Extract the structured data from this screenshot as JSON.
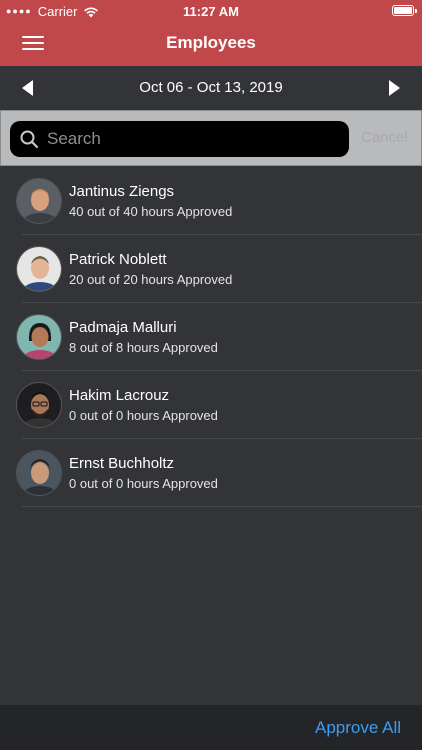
{
  "status_bar": {
    "carrier": "Carrier",
    "time": "11:27 AM"
  },
  "nav": {
    "title": "Employees",
    "menu_icon": "hamburger-menu-icon"
  },
  "week": {
    "range": "Oct 06 - Oct 13, 2019",
    "prev_icon": "triangle-left-icon",
    "next_icon": "triangle-right-icon"
  },
  "search": {
    "placeholder": "Search",
    "value": "",
    "cancel_label": "Cancel"
  },
  "employees": [
    {
      "name": "Jantinus Ziengs",
      "hours": "40 out of 40 hours Approved"
    },
    {
      "name": "Patrick Noblett",
      "hours": "20 out of 20 hours Approved"
    },
    {
      "name": "Padmaja Malluri",
      "hours": "8 out of 8 hours Approved"
    },
    {
      "name": "Hakim Lacrouz",
      "hours": "0 out of 0 hours Approved"
    },
    {
      "name": "Ernst Buchholtz",
      "hours": "0 out of 0 hours Approved"
    }
  ],
  "toolbar": {
    "approve_all_label": "Approve All"
  },
  "colors": {
    "header": "#c0484a",
    "background": "#333437",
    "accent": "#3c9cf0"
  }
}
